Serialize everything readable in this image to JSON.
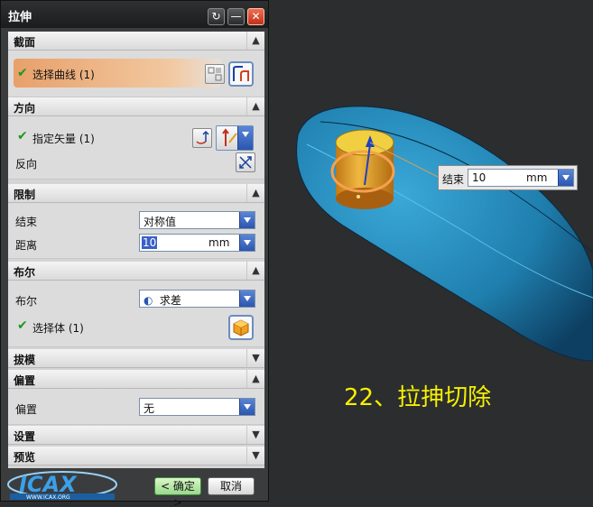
{
  "dialog": {
    "title": "拉伸",
    "sections": {
      "section": {
        "header": "截面",
        "select_curve_label": "选择曲线 (1)"
      },
      "direction": {
        "header": "方向",
        "specify_vector_label": "指定矢量 (1)",
        "reverse_label": "反向"
      },
      "limits": {
        "header": "限制",
        "end_label": "结束",
        "end_value": "对称值",
        "distance_label": "距离",
        "distance_value": "10",
        "distance_unit": "mm"
      },
      "boolean": {
        "header": "布尔",
        "boolean_label": "布尔",
        "boolean_value": "求差",
        "select_body_label": "选择体 (1)"
      },
      "draft": {
        "header": "拔模"
      },
      "offset": {
        "header": "偏置",
        "offset_label": "偏置",
        "offset_value": "无"
      },
      "settings": {
        "header": "设置"
      },
      "preview": {
        "header": "预览"
      }
    },
    "buttons": {
      "ok": "< 确定 >",
      "cancel": "取消"
    },
    "logo_text": "ICAX",
    "logo_url_text": "WWW.ICAX.ORG"
  },
  "viewport": {
    "handle": {
      "label": "结束",
      "value": "10",
      "unit": "mm"
    },
    "caption": "22、拉抻切除"
  },
  "colors": {
    "accent": "#2a56b0",
    "check": "#1a9a1a",
    "caption": "#f5f000",
    "model_body": "#1f7fae",
    "cylinder": "#e8a830"
  }
}
